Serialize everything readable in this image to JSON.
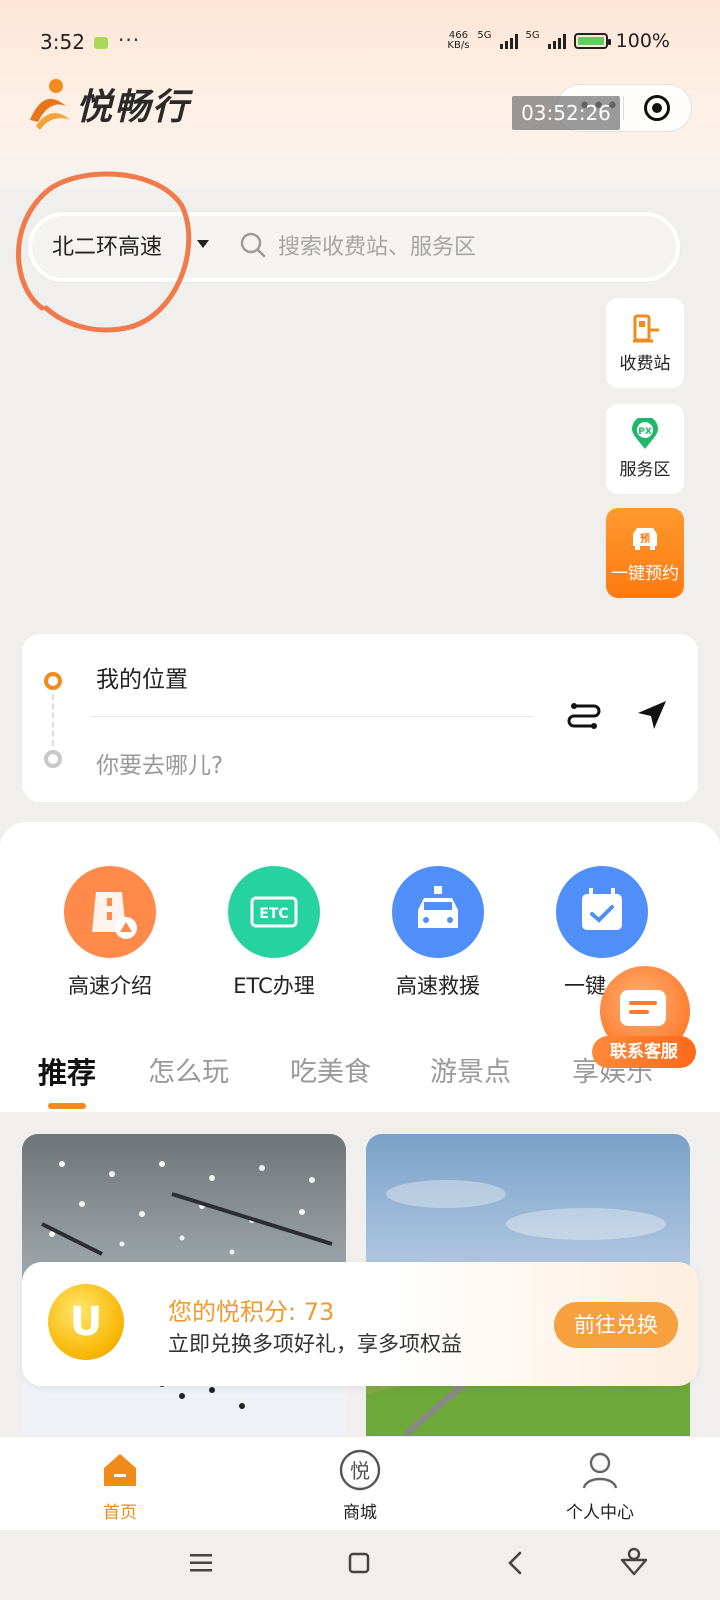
{
  "status_bar": {
    "time": "3:52",
    "dots": "···",
    "net_speed_top": "466",
    "net_speed_bottom": "KB/s",
    "net1": "5G",
    "net2": "5G",
    "battery": "100%"
  },
  "header": {
    "app_name": "悦畅行",
    "timer": "03:52:26"
  },
  "search": {
    "highway": "北二环高速",
    "placeholder": "搜索收费站、服务区"
  },
  "side_buttons": [
    {
      "label": "收费站",
      "icon": "toll-station-icon"
    },
    {
      "label": "服务区",
      "icon": "service-area-icon"
    },
    {
      "label": "一键预约",
      "icon": "reserve-icon",
      "badge": "预"
    }
  ],
  "route": {
    "origin": "我的位置",
    "destination_placeholder": "你要去哪儿?"
  },
  "services": [
    {
      "label": "高速介绍",
      "color": "#ff8a4a"
    },
    {
      "label": "ETC办理",
      "color": "#26d3a0",
      "badge": "ETC"
    },
    {
      "label": "高速救援",
      "color": "#4f8ff7"
    },
    {
      "label": "一键",
      "color": "#4f8ff7"
    }
  ],
  "tabs": [
    "推荐",
    "怎么玩",
    "吃美食",
    "游景点",
    "享娱乐"
  ],
  "points": {
    "title": "您的悦积分: 73",
    "subtitle": "立即兑换多项好礼，享多项权益",
    "button": "前往兑换"
  },
  "customer_service": "联系客服",
  "bottom_nav": [
    {
      "label": "首页",
      "active": true
    },
    {
      "label": "商城",
      "active": false,
      "glyph": "悦"
    },
    {
      "label": "个人中心",
      "active": false
    }
  ],
  "colors": {
    "accent": "#f28a1c",
    "brand_orange": "#ff7a10"
  }
}
